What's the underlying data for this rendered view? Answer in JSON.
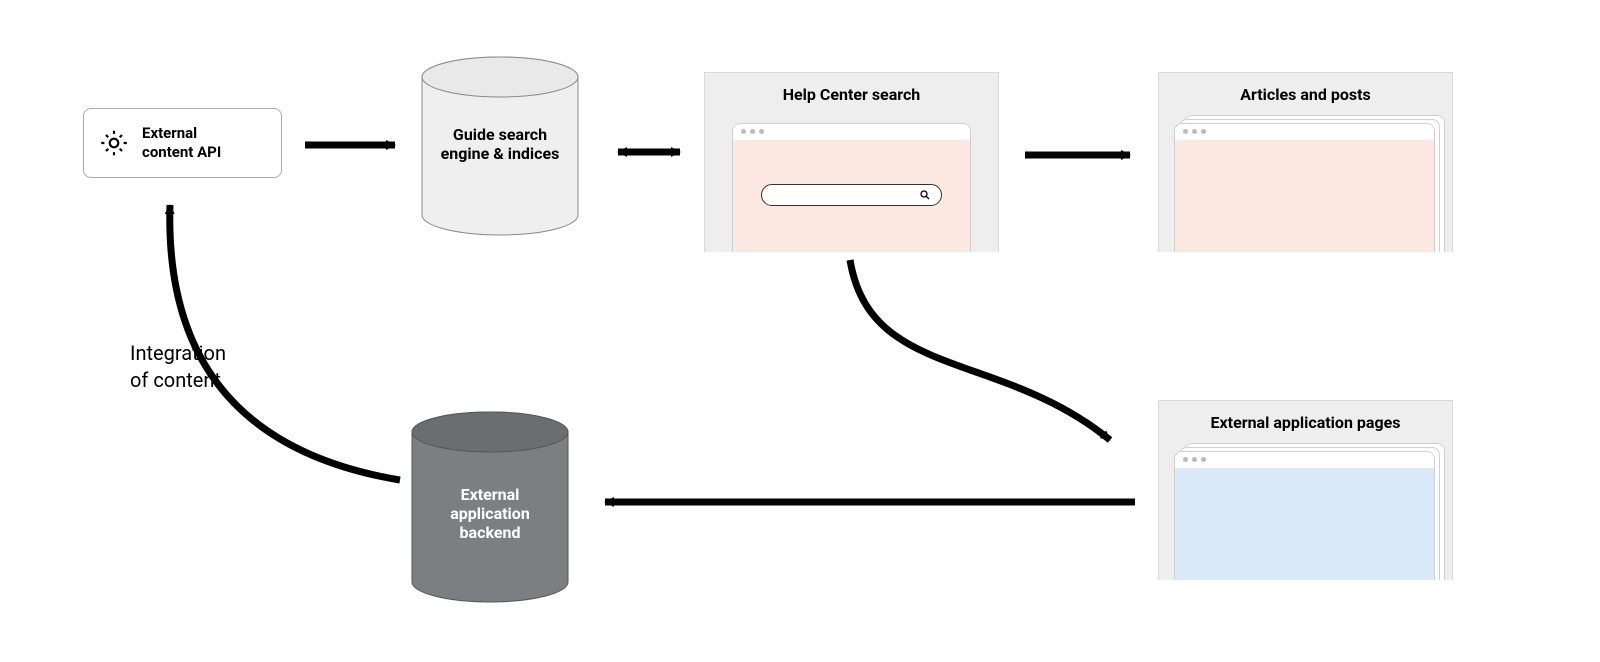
{
  "nodes": {
    "api": {
      "line1": "External",
      "line2": "content API"
    },
    "guide_db": {
      "line1": "Guide search",
      "line2": "engine & indices"
    },
    "help_center": {
      "title": "Help Center search"
    },
    "articles": {
      "title": "Articles and posts"
    },
    "external_pages": {
      "title": "External application pages"
    },
    "external_backend": {
      "line1": "External",
      "line2": "application",
      "line3": "backend"
    }
  },
  "annotations": {
    "integration": {
      "line1": "Integration",
      "line2": "of content"
    }
  }
}
